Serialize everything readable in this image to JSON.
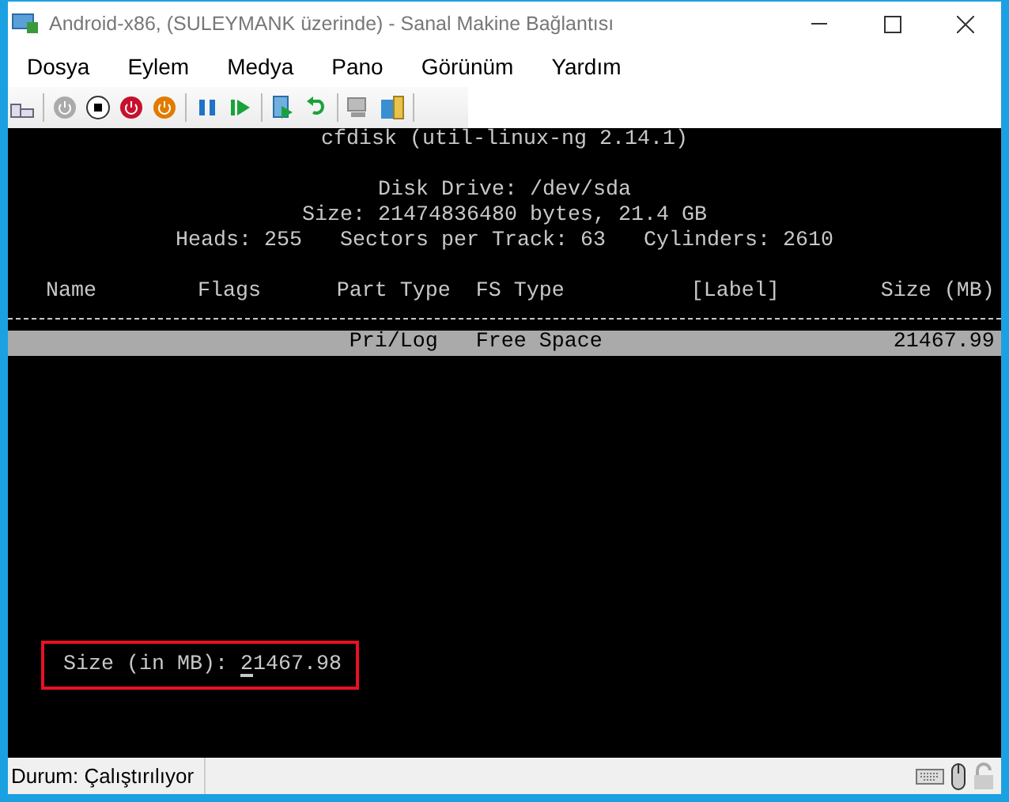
{
  "window": {
    "title": "Android-x86, (SULEYMANK üzerinde) - Sanal Makine Bağlantısı"
  },
  "menu": [
    "Dosya",
    "Eylem",
    "Medya",
    "Pano",
    "Görünüm",
    "Yardım"
  ],
  "console": {
    "title": "cfdisk (util-linux-ng 2.14.1)",
    "info": [
      "Disk Drive: /dev/sda",
      "Size: 21474836480 bytes, 21.4 GB",
      "Heads: 255   Sectors per Track: 63   Cylinders: 2610"
    ],
    "columns": [
      "Name",
      "Flags",
      "Part Type",
      "FS Type",
      "[Label]",
      "Size (MB)"
    ],
    "rows": [
      {
        "selected": true,
        "cells": [
          "",
          "",
          "Pri/Log",
          "Free Space",
          "",
          "21467.99"
        ]
      }
    ],
    "prompt": {
      "label": "Size (in MB):",
      "value": "21467.98"
    }
  },
  "status_bar": {
    "text": "Durum: Çalıştırılıyor"
  }
}
